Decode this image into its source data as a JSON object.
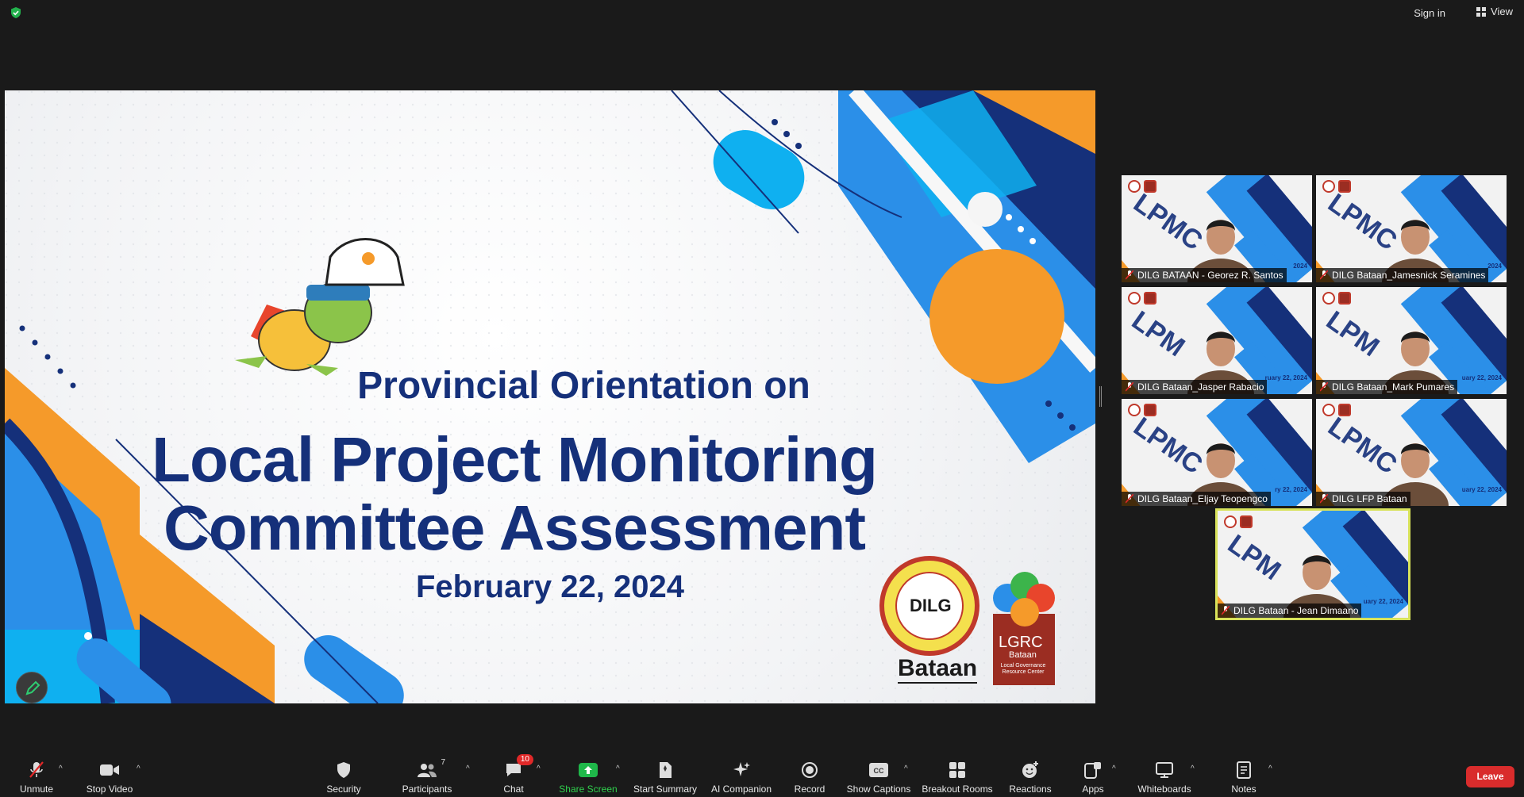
{
  "topbar": {
    "signin_label": "Sign in",
    "view_label": "View"
  },
  "slide": {
    "line1": "Provincial Orientation on",
    "line2": "Local Project Monitoring",
    "line3": "Committee Assessment",
    "date": "February 22, 2024",
    "logo_dilg": "DILG",
    "logo_bataan": "Bataan",
    "logo_lgrc": "LGRC",
    "logo_lgrc_sub": "Bataan",
    "logo_lgrc_caption": "Local Governance Resource Center"
  },
  "participants": [
    {
      "name": "DILG BATAAN - Georez R. Santos",
      "tile_text": "LPMC",
      "date": "2024"
    },
    {
      "name": "DILG Bataan_Jamesnick Seramines",
      "tile_text": "LPMC",
      "date": "2024"
    },
    {
      "name": "DILG Bataan_Jasper Rabacio",
      "tile_text": "LPM",
      "date": "ruary 22, 2024"
    },
    {
      "name": "DILG Bataan_Mark Pumares",
      "tile_text": "LPM",
      "date": "uary 22, 2024"
    },
    {
      "name": "DILG Bataan_Eljay Teopengco",
      "tile_text": "LPMC",
      "date": "ry 22, 2024"
    },
    {
      "name": "DILG LFP Bataan",
      "tile_text": "LPMC",
      "date": "uary 22, 2024"
    },
    {
      "name": "DILG Bataan - Jean Dimaano",
      "tile_text": "LPM",
      "date": "uary 22, 2024"
    }
  ],
  "toolbar": {
    "unmute": "Unmute",
    "stop_video": "Stop Video",
    "security": "Security",
    "participants": "Participants",
    "participants_count": "7",
    "chat": "Chat",
    "chat_badge": "10",
    "share_screen": "Share Screen",
    "start_summary": "Start Summary",
    "ai_companion": "AI Companion",
    "record": "Record",
    "show_captions": "Show Captions",
    "breakout_rooms": "Breakout Rooms",
    "reactions": "Reactions",
    "apps": "Apps",
    "whiteboards": "Whiteboards",
    "notes": "Notes",
    "leave": "Leave"
  },
  "colors": {
    "brand_navy": "#15307a",
    "accent_blue": "#2b8fe8",
    "accent_orange": "#f59a2a",
    "leave_red": "#d92c2c",
    "share_green": "#30d14d"
  }
}
